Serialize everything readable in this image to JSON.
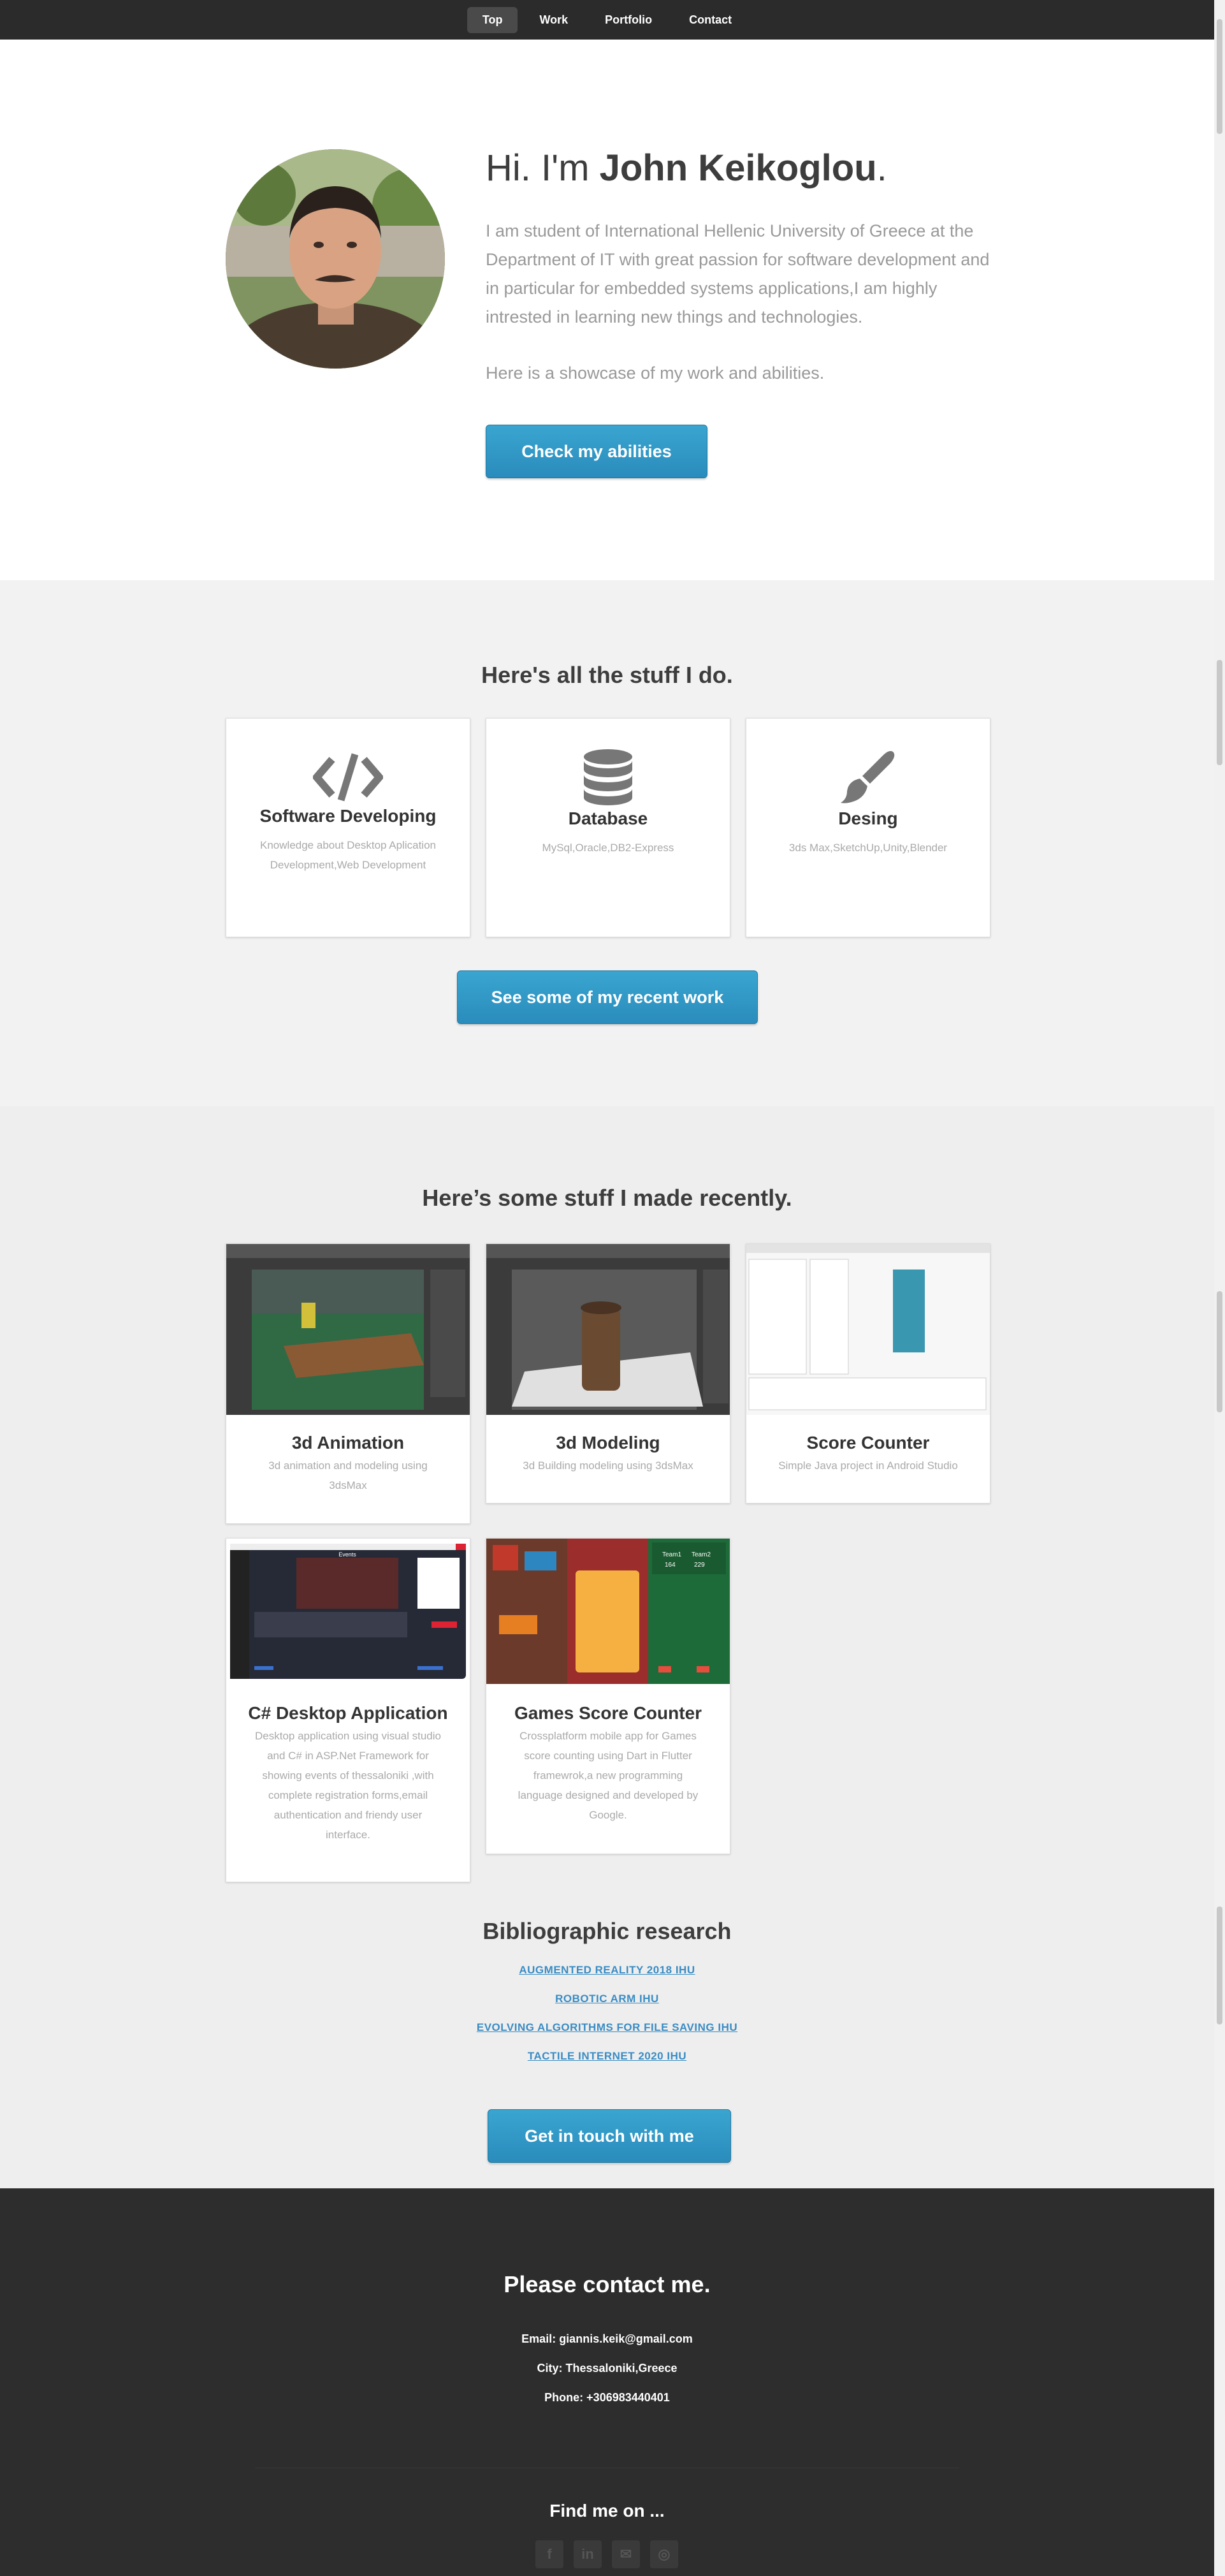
{
  "nav": {
    "items": [
      "Top",
      "Work",
      "Portfolio",
      "Contact"
    ],
    "active": "Top"
  },
  "intro": {
    "greeting": "Hi. I'm ",
    "name": "John Keikoglou",
    "period": ".",
    "paragraph1": "I am student of International Hellenic University of Greece at the Department of IT with great passion for software development and in particular for embedded systems applications,I am highly intrested in learning new things and technologies.",
    "paragraph2": "Here is a showcase of my work and abilities.",
    "button": "Check my abilities"
  },
  "skills": {
    "title": "Here's all the stuff I do.",
    "items": [
      {
        "icon": "code-icon",
        "title": "Software Developing",
        "desc": "Knowledge about Desktop Aplication Development,Web Development"
      },
      {
        "icon": "database-icon",
        "title": "Database",
        "desc": "MySql,Oracle,DB2-Express"
      },
      {
        "icon": "paintbrush-icon",
        "title": "Desing",
        "desc": "3ds Max,SketchUp,Unity,Blender"
      }
    ],
    "button": "See some of my recent work"
  },
  "work": {
    "title": "Here’s some stuff I made recently.",
    "items": [
      {
        "title": "3d Animation",
        "desc": "3d animation and modeling using 3dsMax"
      },
      {
        "title": "3d Modeling",
        "desc": "3d Building modeling using 3dsMax"
      },
      {
        "title": "Score Counter",
        "desc": "Simple Java project in Android Studio"
      },
      {
        "title": "C# Desktop Application",
        "desc": "Desktop application using visual studio and C# in ASP.Net Framework for showing events of thessaloniki ,with complete registration forms,email authentication and friendy user interface."
      },
      {
        "title": "Games Score Counter",
        "desc": "Crossplatform mobile app for Games score counting using Dart in Flutter framewrok,a new programming language designed and developed by Google."
      }
    ],
    "screens": {
      "events_title": "Events",
      "team1": "Team1",
      "team2": "Team2",
      "team1_score": "164",
      "team2_score": "229"
    }
  },
  "biblio": {
    "title": "Bibliographic research",
    "links": [
      "AUGMENTED REALITY 2018 IHU",
      "ROBOTIC ARM IHU",
      "EVOLVING ALGORITHMS FOR FILE SAVING IHU",
      "TACTILE INTERNET 2020 IHU"
    ],
    "button": "Get in touch with me"
  },
  "contact": {
    "title": "Please contact me.",
    "email": "Email: giannis.keik@gmail.com",
    "city": "City: Thessaloniki,Greece",
    "phone": "Phone: +306983440401",
    "find_title": "Find me on ...",
    "social": [
      "facebook-icon",
      "linkedin-icon",
      "email-icon",
      "github-icon"
    ]
  },
  "colors": {
    "accent": "#2f97c6",
    "footer_bg": "#2d2d2d",
    "nav_bg": "#2b2b2b"
  }
}
